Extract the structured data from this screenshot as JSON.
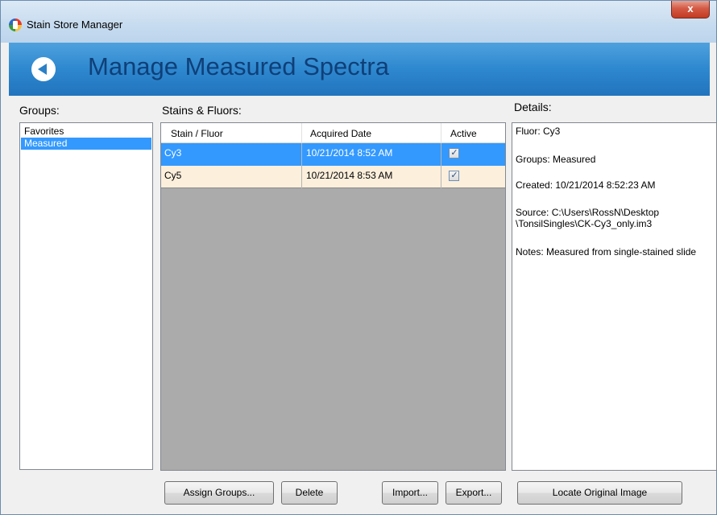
{
  "window": {
    "title": "Stain Store Manager",
    "close_label": "x"
  },
  "banner": {
    "title": "Manage Measured Spectra"
  },
  "groups": {
    "label": "Groups:",
    "items": [
      "Favorites",
      "Measured"
    ],
    "selected": "Measured"
  },
  "stains": {
    "label": "Stains & Fluors:",
    "columns": [
      "Stain / Fluor",
      "Acquired Date",
      "Active"
    ],
    "rows": [
      {
        "name": "Cy3",
        "date": "10/21/2014 8:52 AM",
        "active": true
      },
      {
        "name": "Cy5",
        "date": "10/21/2014 8:53 AM",
        "active": true
      }
    ]
  },
  "details": {
    "label": "Details:",
    "fluor": "Fluor: Cy3",
    "groups": "Groups: Measured",
    "created": "Created: 10/21/2014 8:52:23 AM",
    "source_line1": "Source: C:\\Users\\RossN\\Desktop",
    "source_line2": "\\TonsilSingles\\CK-Cy3_only.im3",
    "notes": "Notes: Measured from single-stained slide"
  },
  "buttons": {
    "assign_groups": "Assign Groups...",
    "delete": "Delete",
    "import": "Import...",
    "export": "Export...",
    "locate": "Locate Original Image"
  },
  "colors": {
    "banner": "#2e88cf",
    "banner_title": "#0f3f78",
    "selection": "#3399ff",
    "alt_row": "#fcefdc",
    "grid_background": "#ababab"
  }
}
